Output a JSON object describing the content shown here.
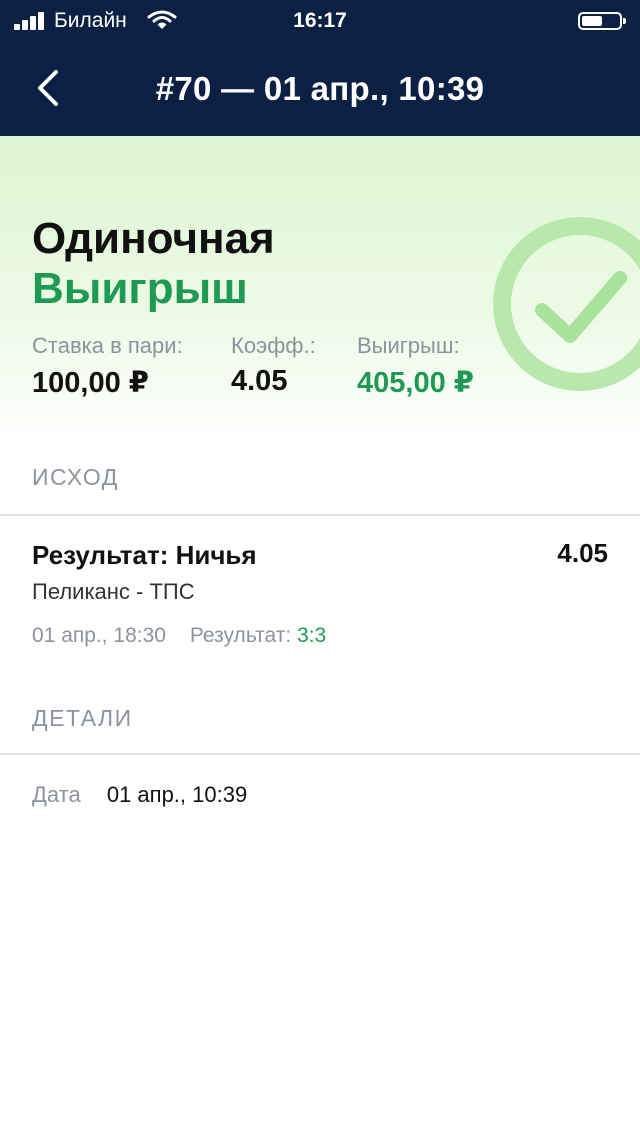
{
  "status_bar": {
    "carrier": "Билайн",
    "time": "16:17",
    "battery_level": 0.55
  },
  "header": {
    "title": "#70 — 01 апр., 10:39",
    "background": "#0c2044"
  },
  "summary": {
    "bet_type": "Одиночная",
    "status": "Выигрыш",
    "status_icon": "check-circle-icon",
    "stake_label": "Ставка в пари:",
    "stake_value": "100,00 ₽",
    "odds_label": "Коэфф.:",
    "odds_value": "4.05",
    "win_label": "Выигрыш:",
    "win_value": "405,00 ₽"
  },
  "outcome_section": {
    "header": "ИСХОД",
    "item": {
      "title": "Результат: Ничья",
      "odds": "4.05",
      "event": "Пеликанс - ТПС",
      "date": "01 апр., 18:30",
      "result_label": "Результат:",
      "result_value": "3:3"
    }
  },
  "details_section": {
    "header": "ДЕТАЛИ",
    "date_label": "Дата",
    "date_value": "01 апр., 10:39"
  },
  "colors": {
    "accent_green": "#1f9a55",
    "muted_text": "#8b949e",
    "success_bg": "#ddf6d2"
  }
}
